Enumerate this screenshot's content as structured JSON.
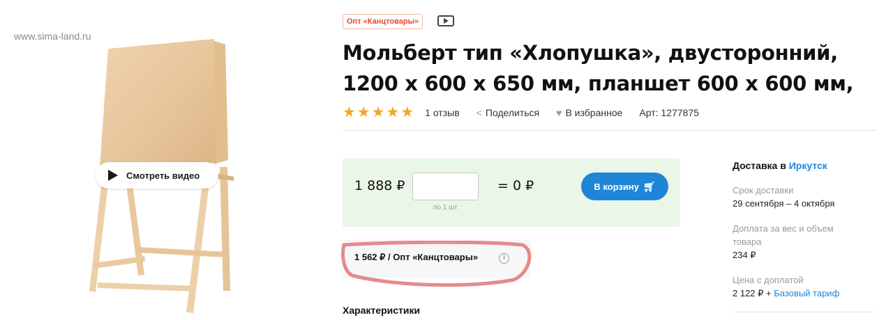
{
  "watermark": "www.sima-land.ru",
  "video_button": "Смотреть видео",
  "badge": "Опт «Канцтовары»",
  "title_line1": "Мольберт тип «Хлопушка», двусторонний,",
  "title_line2": "1200 х 600 х 650 мм, планшет 600 х 600 мм,",
  "rating": {
    "stars": 5,
    "reviews": "1 отзыв"
  },
  "share": "Поделиться",
  "favorite": "В избранное",
  "article": "Арт: 1277875",
  "price": "1 888 ₽",
  "qty_note": "по 1 шт",
  "total": "= 0 ₽",
  "cart_button": "В корзину",
  "wholesale_price": "1 562 ₽ / Опт «Канцтовары»",
  "characteristics": "Характеристики",
  "delivery": {
    "title_prefix": "Доставка в",
    "city": "Иркутск",
    "term_label": "Срок доставки",
    "term_value": "29 сентября – 4 октября",
    "surcharge_label_1": "Доплата за вес и объем",
    "surcharge_label_2": "товара",
    "surcharge_value": "234 ₽",
    "price_label": "Цена с доплатой",
    "price_value": "2 122 ₽ +",
    "tariff_link": "Базовый тариф"
  },
  "colors": {
    "accent": "#1f85d6",
    "price_bg": "#eaf6e7",
    "star": "#f5a623",
    "badge": "#e8482c",
    "highlight": "#e68a8a"
  }
}
